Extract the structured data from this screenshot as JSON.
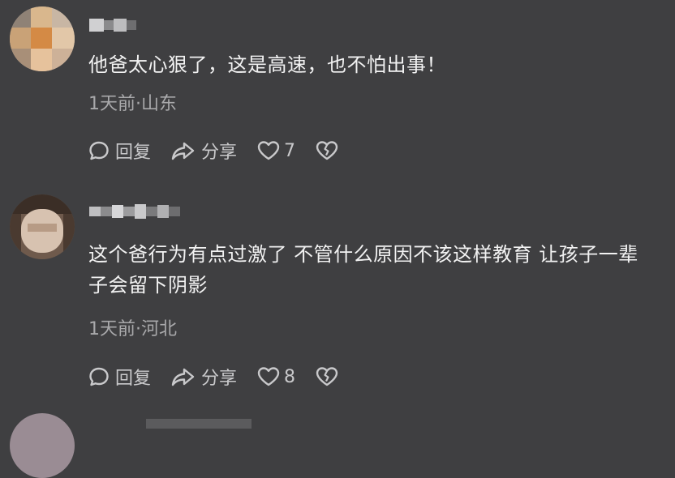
{
  "comments": [
    {
      "text": "他爸太心狠了，这是高速，也不怕出事！",
      "meta": "1天前·山东",
      "reply_label": "回复",
      "share_label": "分享",
      "likes": "7"
    },
    {
      "text": "这个爸行为有点过激了 不管什么原因不该这样教育  让孩子一辈子会留下阴影",
      "meta": "1天前·河北",
      "reply_label": "回复",
      "share_label": "分享",
      "likes": "8"
    }
  ],
  "icons": {
    "reply": "comment-bubble-icon",
    "share": "share-arrow-icon",
    "like": "heart-icon",
    "dislike": "broken-heart-icon"
  },
  "colors": {
    "background": "#3f3f41",
    "text": "#f2f2f2",
    "meta": "#a9a9ab",
    "action": "#c9c9cb"
  }
}
